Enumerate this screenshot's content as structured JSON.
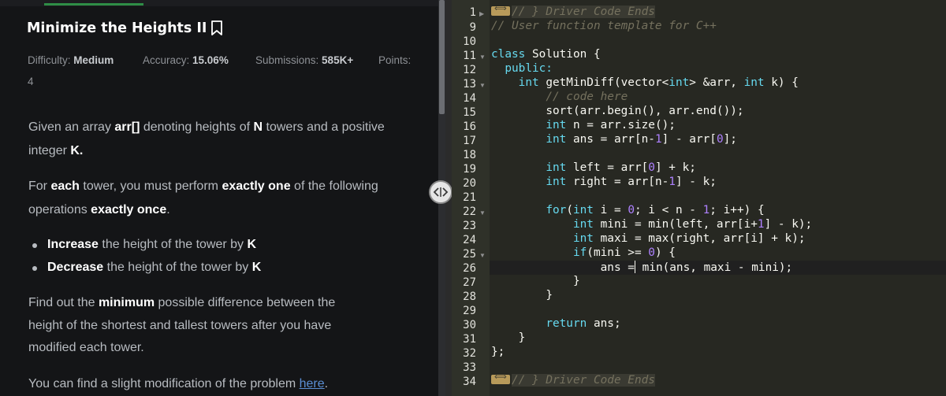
{
  "problem": {
    "title": "Minimize the Heights II",
    "difficulty_label": "Difficulty: ",
    "difficulty_value": "Medium",
    "accuracy_label": "Accuracy: ",
    "accuracy_value": "15.06%",
    "submissions_label": "Submissions: ",
    "submissions_value": "585K+",
    "points_label": "Points:",
    "points_value": "4"
  },
  "statement": {
    "p1_a": "Given an array ",
    "p1_b": "arr[]",
    "p1_c": " denoting heights of ",
    "p1_d": "N",
    "p1_e": " towers and a positive",
    "p1_f": "integer ",
    "p1_g": "K.",
    "p2_a": "For ",
    "p2_b": "each",
    "p2_c": " tower, you must perform ",
    "p2_d": "exactly one",
    "p2_e": " of the following",
    "p2_f": "operations ",
    "p2_g": "exactly once",
    "p2_h": ".",
    "b1_a": "Increase",
    "b1_b": " the height of the tower by ",
    "b1_c": "K",
    "b2_a": "Decrease",
    "b2_b": " the height of the tower by ",
    "b2_c": "K",
    "p3_a": "Find out the ",
    "p3_b": "minimum",
    "p3_c": " possible difference between the",
    "p3_d": "height of the shortest and tallest towers after you have",
    "p3_e": "modified each tower.",
    "p4_a": "You can find a slight modification of the problem ",
    "p4_link": "here",
    "p4_b": "."
  },
  "editor": {
    "line_numbers": [
      "1",
      "9",
      "10",
      "11",
      "12",
      "13",
      "14",
      "15",
      "16",
      "17",
      "18",
      "19",
      "20",
      "21",
      "22",
      "23",
      "24",
      "25",
      "26",
      "27",
      "28",
      "29",
      "30",
      "31",
      "32",
      "33",
      "34"
    ],
    "folded_top": "// } Driver Code Ends",
    "folded_bottom": "// } Driver Code Ends",
    "cursor_line_number": "26",
    "code": {
      "l9": "// User function template for C++",
      "l11_kw": "class",
      "l11_rest": " Solution {",
      "l12": "public:",
      "l13_kw": "int",
      "l13_a": " getMinDiff(vector<",
      "l13_ty": "int",
      "l13_b": "> &arr, ",
      "l13_kw2": "int",
      "l13_c": " k) {",
      "l14": "// code here",
      "l15": "sort(arr.begin(), arr.end());",
      "l16_kw": "int",
      "l16_rest": " n = arr.size();",
      "l17_kw": "int",
      "l17_a": " ans = arr[n-",
      "l17_n1": "1",
      "l17_b": "] - arr[",
      "l17_n2": "0",
      "l17_c": "];",
      "l19_kw": "int",
      "l19_a": " left = arr[",
      "l19_n": "0",
      "l19_b": "] + k;",
      "l20_kw": "int",
      "l20_a": " right = arr[n-",
      "l20_n": "1",
      "l20_b": "] - k;",
      "l22_kw": "for",
      "l22_a": "(",
      "l22_kw2": "int",
      "l22_b": " i = ",
      "l22_n": "0",
      "l22_c": "; i < n - ",
      "l22_n2": "1",
      "l22_d": "; i++) {",
      "l23_kw": "int",
      "l23_a": " mini = min(left, arr[i+",
      "l23_n": "1",
      "l23_b": "] - k);",
      "l24_kw": "int",
      "l24_rest": " maxi = max(right, arr[i] + k);",
      "l25_kw": "if",
      "l25_a": "(mini >= ",
      "l25_n": "0",
      "l25_b": ") {",
      "l26_a": "ans =",
      "l26_b": " min(ans, maxi - mini);",
      "l27": "}",
      "l28": "}",
      "l30_kw": "return",
      "l30_rest": " ans;",
      "l31": "}",
      "l32": "};"
    }
  },
  "colors": {
    "tab_accent": "#2f8d46",
    "link": "#5b8fd4",
    "editor_bg": "#272822",
    "keyword": "#66d9ef",
    "number": "#ae81ff",
    "comment": "#75715e"
  }
}
